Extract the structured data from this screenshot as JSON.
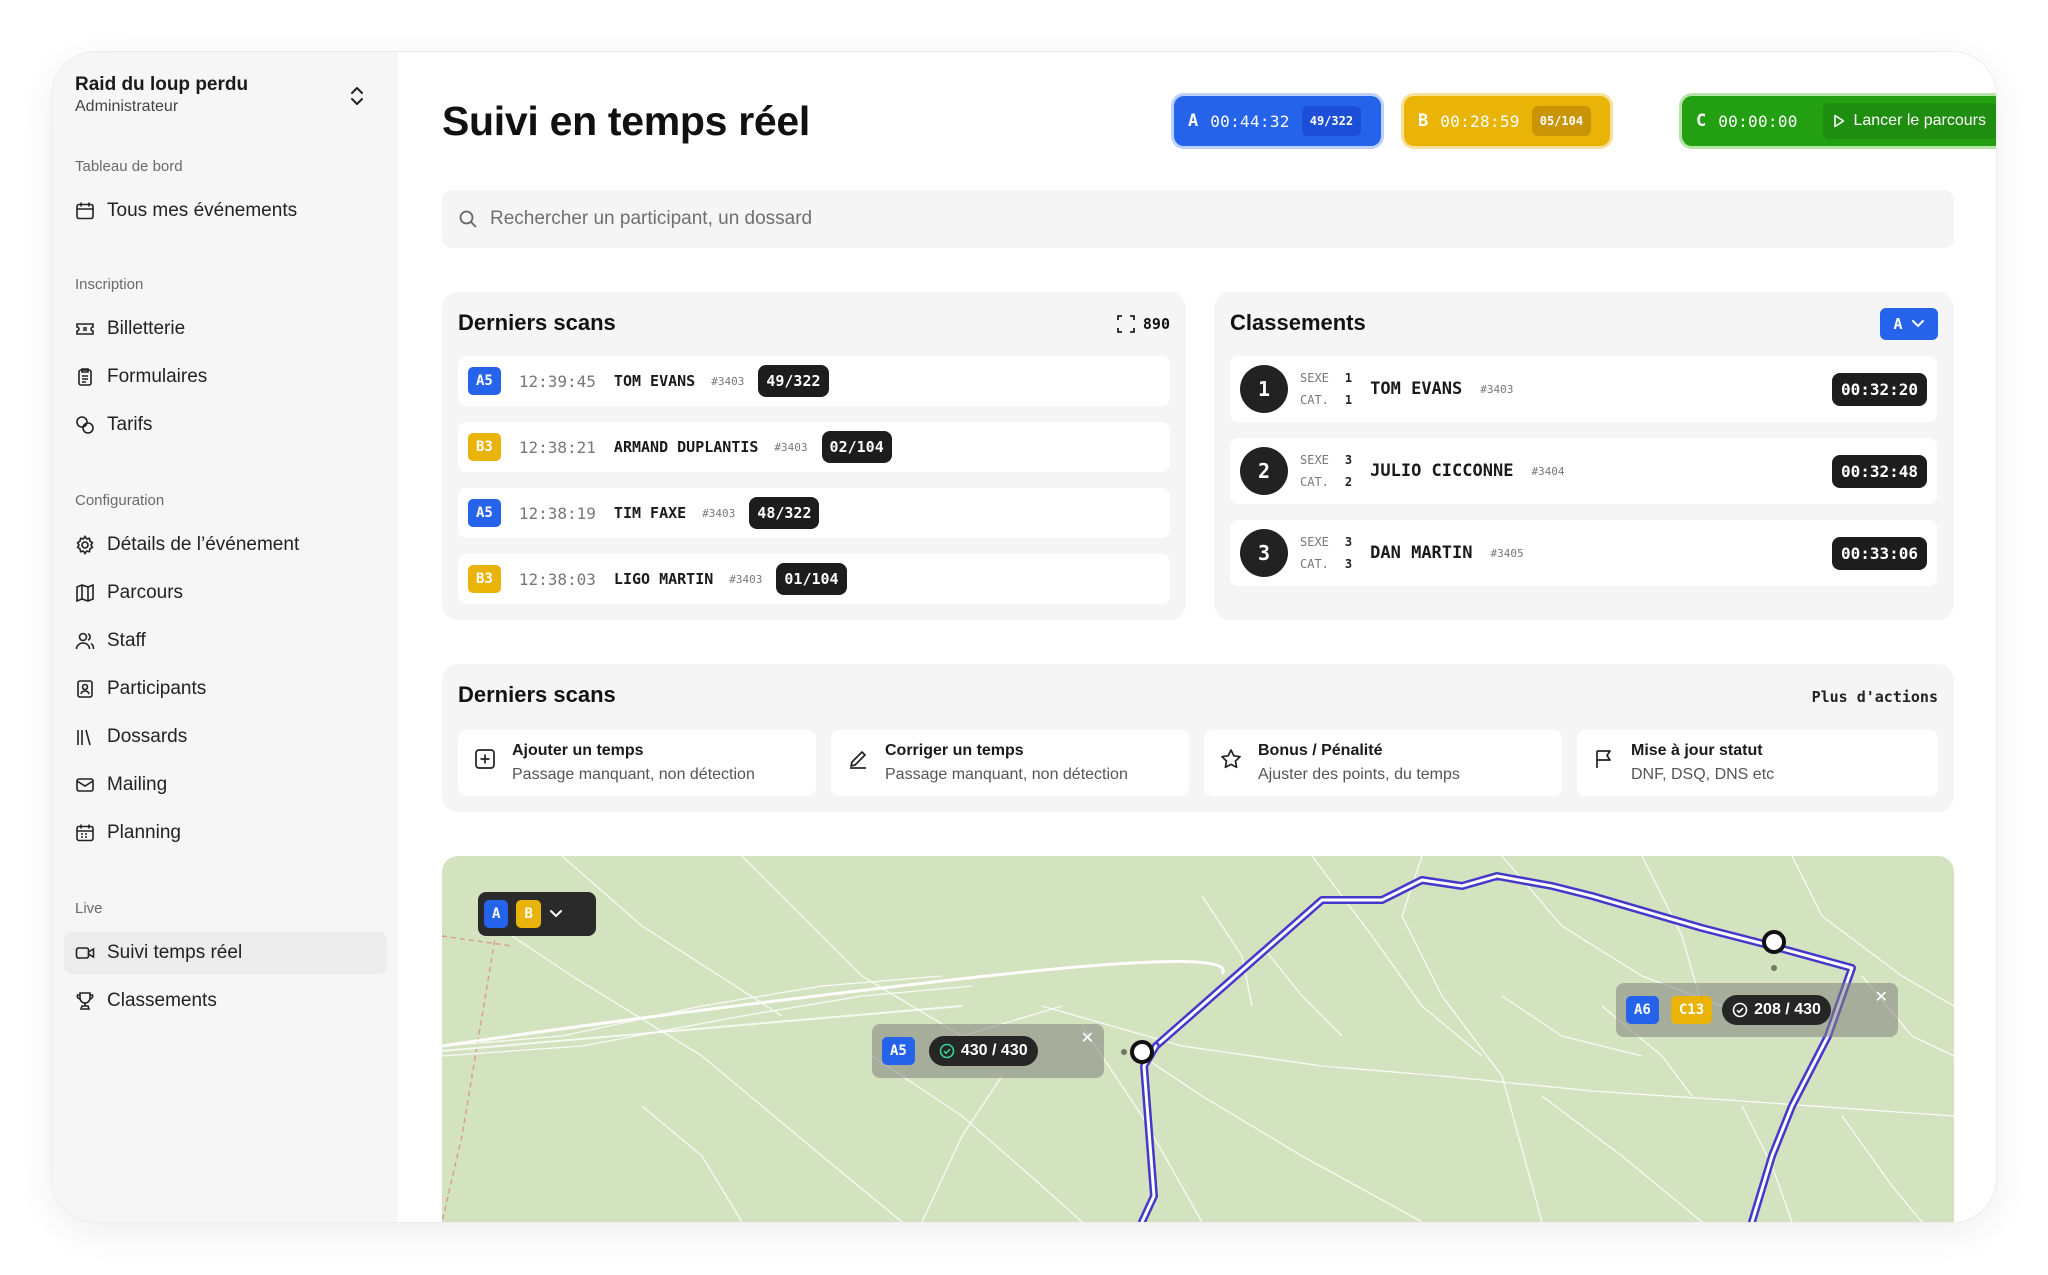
{
  "sidebar": {
    "brand_name": "Raid du loup perdu",
    "brand_role": "Administrateur",
    "sections": {
      "dashboard": "Tableau de bord",
      "inscription": "Inscription",
      "configuration": "Configuration",
      "live": "Live"
    },
    "items": {
      "events": "Tous mes événements",
      "billetterie": "Billetterie",
      "formulaires": "Formulaires",
      "tarifs": "Tarifs",
      "details": "Détails de l’événement",
      "parcours": "Parcours",
      "staff": "Staff",
      "participants": "Participants",
      "dossards": "Dossards",
      "mailing": "Mailing",
      "planning": "Planning",
      "suivi": "Suivi temps réel",
      "classements": "Classements"
    }
  },
  "header": {
    "title": "Suivi en temps réel",
    "timers": {
      "a": {
        "letter": "A",
        "time": "00:44:32",
        "count": "49/322"
      },
      "b": {
        "letter": "B",
        "time": "00:28:59",
        "count": "05/104"
      },
      "c": {
        "letter": "C",
        "time": "00:00:00",
        "action": "Lancer le parcours"
      }
    }
  },
  "search": {
    "placeholder": "Rechercher un participant, un dossard"
  },
  "scans": {
    "title": "Derniers scans",
    "count": "890",
    "rows": [
      {
        "chip": "A5",
        "time": "12:39:45",
        "name": "TOM EVANS",
        "bib": "#3403",
        "pos": "49/322"
      },
      {
        "chip": "B3",
        "time": "12:38:21",
        "name": "ARMAND DUPLANTIS",
        "bib": "#3403",
        "pos": "02/104"
      },
      {
        "chip": "A5",
        "time": "12:38:19",
        "name": "TIM FAXE",
        "bib": "#3403",
        "pos": "48/322"
      },
      {
        "chip": "B3",
        "time": "12:38:03",
        "name": "LIGO MARTIN",
        "bib": "#3403",
        "pos": "01/104"
      }
    ]
  },
  "ranking": {
    "title": "Classements",
    "filter": "A",
    "sexe_label": "SEXE",
    "cat_label": "CAT.",
    "rows": [
      {
        "rank": "1",
        "sexe": "1",
        "cat": "1",
        "name": "TOM EVANS",
        "bib": "#3403",
        "time": "00:32:20"
      },
      {
        "rank": "2",
        "sexe": "3",
        "cat": "2",
        "name": "JULIO CICCONNE",
        "bib": "#3404",
        "time": "00:32:48"
      },
      {
        "rank": "3",
        "sexe": "3",
        "cat": "3",
        "name": "DAN MARTIN",
        "bib": "#3405",
        "time": "00:33:06"
      }
    ]
  },
  "actions": {
    "title": "Derniers scans",
    "more": "Plus d'actions",
    "items": [
      {
        "title": "Ajouter un temps",
        "desc": "Passage manquant, non détection"
      },
      {
        "title": "Corriger un temps",
        "desc": "Passage manquant, non détection"
      },
      {
        "title": "Bonus / Pénalité",
        "desc": "Ajuster des points, du temps"
      },
      {
        "title": "Mise à jour statut",
        "desc": "DNF, DSQ, DNS etc"
      }
    ]
  },
  "map": {
    "filter_a": "A",
    "filter_b": "B",
    "marker1": {
      "chip": "A5",
      "count": "430 / 430"
    },
    "marker2": {
      "chip1": "A6",
      "chip2": "C13",
      "count": "208 / 430"
    },
    "colors": {
      "route": "#4338ca",
      "ground": "#d3e2bf"
    }
  }
}
